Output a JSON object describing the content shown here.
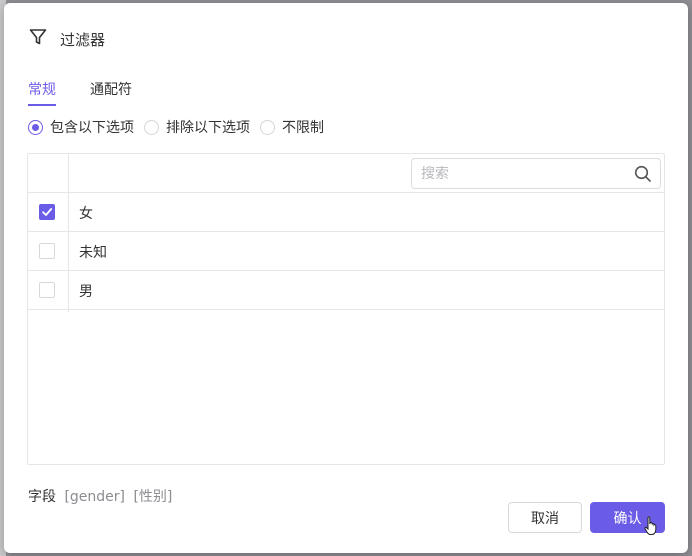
{
  "dialog": {
    "title": "过滤器",
    "title_icon": "filter-icon"
  },
  "tabs": [
    {
      "label": "常规",
      "active": true
    },
    {
      "label": "通配符",
      "active": false
    }
  ],
  "radio_options": [
    {
      "label": "包含以下选项",
      "selected": true
    },
    {
      "label": "排除以下选项",
      "selected": false
    },
    {
      "label": "不限制",
      "selected": false
    }
  ],
  "search": {
    "placeholder": "搜索",
    "value": "",
    "icon": "search-icon"
  },
  "rows": [
    {
      "label": "女",
      "checked": true
    },
    {
      "label": "未知",
      "checked": false
    },
    {
      "label": "男",
      "checked": false
    }
  ],
  "field": {
    "label": "字段",
    "name": "[gender]",
    "alias": "[性别]"
  },
  "buttons": {
    "cancel": "取消",
    "confirm": "确认"
  },
  "colors": {
    "accent": "#6b5ce7",
    "border": "#e6e6e9"
  }
}
